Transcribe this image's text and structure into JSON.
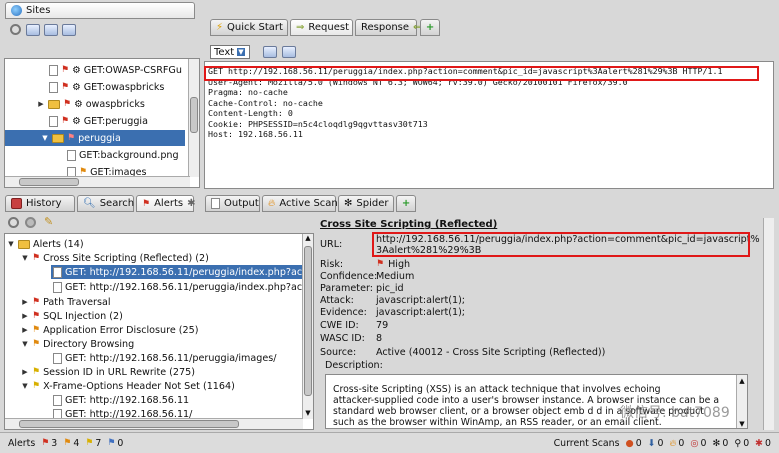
{
  "top_left_tab": {
    "label": "Sites"
  },
  "top_tabs": [
    {
      "label": "Quick Start"
    },
    {
      "label": "Request"
    },
    {
      "label": "Response"
    },
    {
      "label": "+"
    }
  ],
  "view_mode": {
    "label": "Text"
  },
  "sites_tree": [
    {
      "label": "GET:OWASP-CSRFGu"
    },
    {
      "label": "GET:owaspbricks"
    },
    {
      "label": "owaspbricks"
    },
    {
      "label": "GET:peruggia"
    },
    {
      "label": "peruggia"
    },
    {
      "label": "GET:background.png"
    },
    {
      "label": "GET:images"
    }
  ],
  "request_lines": [
    "GET http://192.168.56.11/peruggia/index.php?action=comment&pic_id=javascript%3Aalert%281%29%3B HTTP/1.1",
    "User-Agent: Mozilla/5.0 (Windows NT 6.3; WOW64; rv:39.0) Gecko/20100101 Firefox/39.0",
    "Pragma: no-cache",
    "Cache-Control: no-cache",
    "Content-Length: 0",
    "Cookie: PHPSESSID=n5c4cloqdlg9qgvttasv30t713",
    "Host: 192.168.56.11"
  ],
  "bottom_tabs": [
    {
      "label": "History"
    },
    {
      "label": "Search"
    },
    {
      "label": "Alerts"
    },
    {
      "label": "Output"
    },
    {
      "label": "Active Scan"
    },
    {
      "label": "Spider"
    },
    {
      "label": "+"
    }
  ],
  "alerts_tree": [
    {
      "label": "Alerts (14)"
    },
    {
      "label": "Cross Site Scripting (Reflected) (2)"
    },
    {
      "label": "GET: http://192.168.56.11/peruggia/index.php?act"
    },
    {
      "label": "GET: http://192.168.56.11/peruggia/index.php?act"
    },
    {
      "label": "Path Traversal"
    },
    {
      "label": "SQL Injection (2)"
    },
    {
      "label": "Application Error Disclosure (25)"
    },
    {
      "label": "Directory Browsing"
    },
    {
      "label": "GET: http://192.168.56.11/peruggia/images/"
    },
    {
      "label": "Session ID in URL Rewrite (275)"
    },
    {
      "label": "X-Frame-Options Header Not Set (1164)"
    },
    {
      "label": "GET: http://192.168.56.11"
    },
    {
      "label": "GET: http://192.168.56.11/"
    }
  ],
  "alert_detail": {
    "title": "Cross Site Scripting (Reflected)",
    "url_label": "URL:",
    "url_line1": "http://192.168.56.11/peruggia/index.php?action=comment&pic_id=javascript%",
    "url_line2": "3Aalert%281%29%3B",
    "risk_label": "Risk:",
    "risk_value": "High",
    "confidence_label": "Confidence:",
    "confidence_value": "Medium",
    "parameter_label": "Parameter:",
    "parameter_value": "pic_id",
    "attack_label": "Attack:",
    "attack_value": "javascript:alert(1);",
    "evidence_label": "Evidence:",
    "evidence_value": "javascript:alert(1);",
    "cwe_label": "CWE ID:",
    "cwe_value": "79",
    "wasc_label": "WASC ID:",
    "wasc_value": "8",
    "source_label": "Source:",
    "source_value": "Active (40012 - Cross Site Scripting (Reflected))",
    "description_label": "Description:",
    "description_lines": [
      "Cross-site Scripting (XSS) is an attack technique that involves echoing",
      "attacker-supplied code into a user's browser instance. A browser instance can be a",
      "standard web browser client, or a browser object emb  d  d in a software product",
      "such as the browser within WinAmp, an RSS reader, or an email client."
    ]
  },
  "status_bar": {
    "alerts_label": "Alerts",
    "high": "3",
    "medium": "4",
    "low": "7",
    "info": "0",
    "current_scans_label": "Current Scans",
    "scan_counts": [
      "0",
      "0",
      "0",
      "0",
      "0",
      "0",
      "0"
    ]
  },
  "watermark": "微信号: bat7089"
}
